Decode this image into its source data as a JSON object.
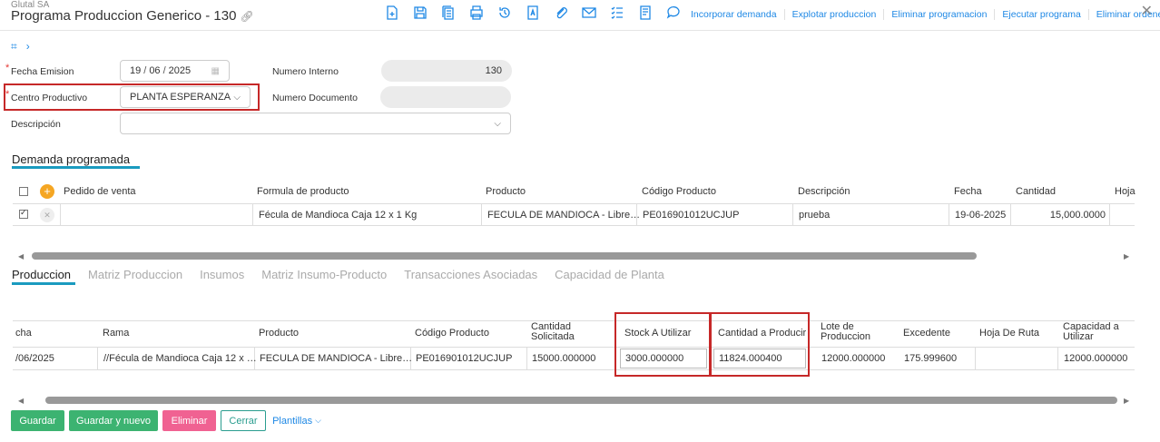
{
  "header": {
    "company": "Glutal SA",
    "title": "Programa Produccion Generico - 130",
    "actions": [
      "Incorporar demanda",
      "Explotar produccion",
      "Eliminar programacion",
      "Ejecutar programa",
      "Eliminar ordenes"
    ],
    "icons": [
      "new-document-icon",
      "save-icon",
      "copy-icon",
      "print-icon",
      "history-icon",
      "text-icon",
      "attach-icon",
      "email-icon",
      "checklist-icon",
      "notes-icon",
      "comment-icon"
    ]
  },
  "form": {
    "fecha_emision_label": "Fecha Emision",
    "fecha_day": "19",
    "fecha_month": "06",
    "fecha_year": "2025",
    "numero_interno_label": "Numero Interno",
    "numero_interno_value": "130",
    "centro_label": "Centro Productivo",
    "centro_value": "PLANTA ESPERANZA",
    "numero_documento_label": "Numero Documento",
    "numero_documento_value": "",
    "descripcion_label": "Descripción",
    "descripcion_value": ""
  },
  "demanda": {
    "title": "Demanda programada",
    "headers": [
      "Pedido de venta",
      "Formula de producto",
      "Producto",
      "Código Producto",
      "Descripción",
      "Fecha",
      "Cantidad",
      "Hoja"
    ],
    "row": {
      "pedido": "",
      "formula": "Fécula de Mandioca Caja 12 x 1 Kg",
      "producto": "FECULA DE MANDIOCA - Libre…",
      "codigo": "PE016901012UCJUP",
      "descripcion": "prueba",
      "fecha": "19-06-2025",
      "cantidad": "15,000.0000"
    }
  },
  "tabs": [
    "Produccion",
    "Matriz Produccion",
    "Insumos",
    "Matriz Insumo-Producto",
    "Transacciones Asociadas",
    "Capacidad de Planta"
  ],
  "produccion": {
    "headers": {
      "fecha": "cha",
      "rama": "Rama",
      "producto": "Producto",
      "codigo": "Código Producto",
      "cantidad_solicitada_1": "Cantidad",
      "cantidad_solicitada_2": "Solicitada",
      "stock": "Stock A Utilizar",
      "cantidad_producir": "Cantidad a Producir",
      "lote_1": "Lote de",
      "lote_2": "Produccion",
      "excedente": "Excedente",
      "hoja_ruta": "Hoja De Ruta",
      "capacidad_1": "Capacidad a",
      "capacidad_2": "Utilizar"
    },
    "row": {
      "fecha": "/06/2025",
      "rama": "//Fécula de Mandioca Caja 12 x …",
      "producto": "FECULA DE MANDIOCA - Libre…",
      "codigo": "PE016901012UCJUP",
      "cantidad_solicitada": "15000.000000",
      "stock": "3000.000000",
      "cantidad_producir": "11824.000400",
      "lote": "12000.000000",
      "excedente": "175.999600",
      "hoja_ruta": "",
      "capacidad": "12000.000000"
    }
  },
  "buttons": {
    "guardar": "Guardar",
    "guardar_nuevo": "Guardar y nuevo",
    "eliminar": "Eliminar",
    "cerrar": "Cerrar",
    "plantillas": "Plantillas"
  },
  "colors": {
    "accent": "#1e88e5",
    "green": "#3cb371",
    "pink": "#f06292",
    "highlight": "#c62828",
    "tab_underline": "#1a9bbf"
  }
}
